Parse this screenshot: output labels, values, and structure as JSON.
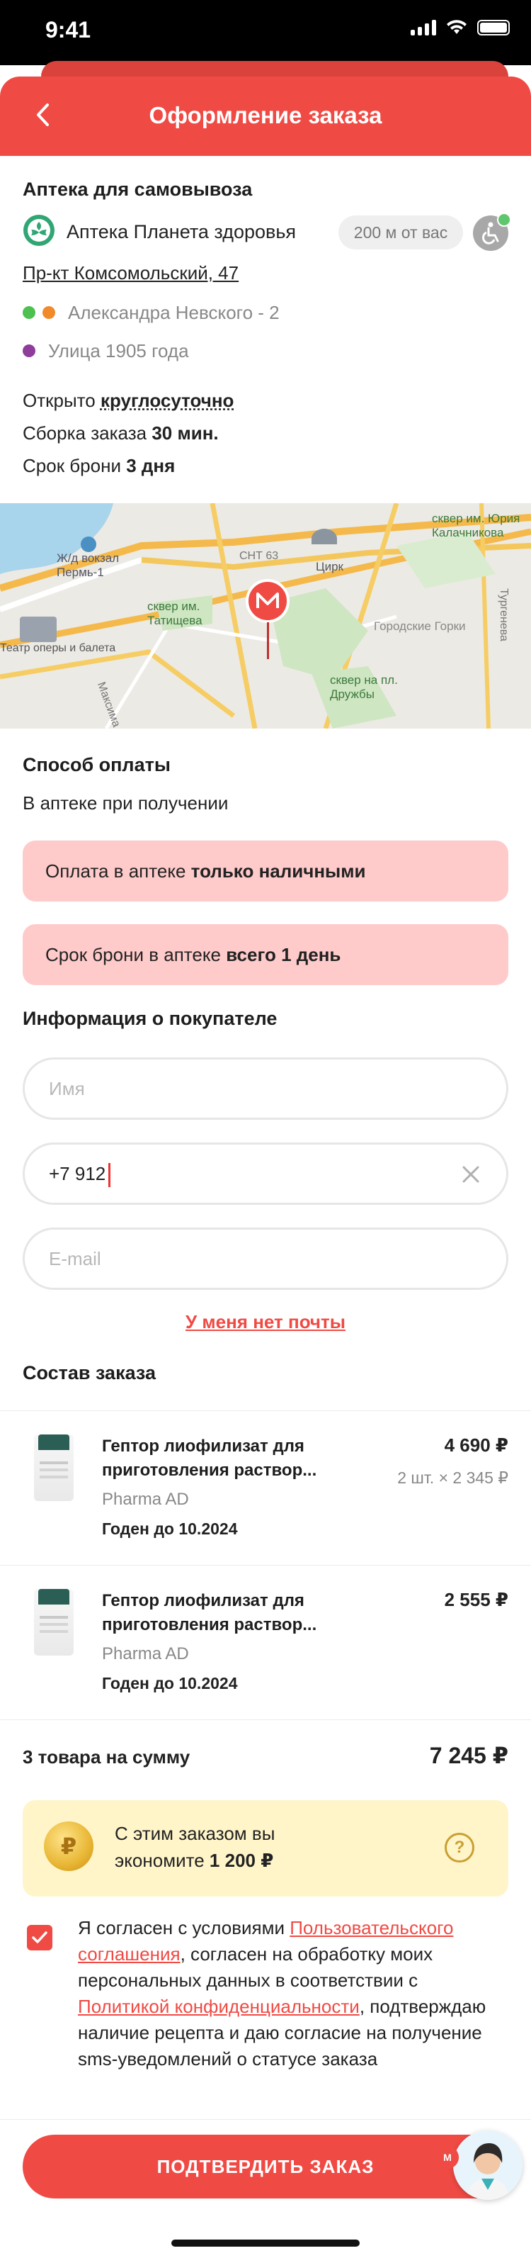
{
  "status_bar": {
    "time": "9:41"
  },
  "header": {
    "title": "Оформление заказа"
  },
  "pickup": {
    "section_title": "Аптека для самовывоза",
    "pharmacy_name": "Аптека Планета здоровья",
    "distance": "200 м от вас",
    "address": "Пр-кт Комсомольский, 47",
    "metro": [
      {
        "name": "Александра Невского - 2",
        "colors": [
          "#4cc14f",
          "#f08a2a"
        ]
      },
      {
        "name": "Улица 1905 года",
        "colors": [
          "#8e3d9b"
        ]
      }
    ],
    "open_prefix": "Открыто ",
    "open_value": "круглосуточно",
    "assembly_prefix": "Сборка заказа ",
    "assembly_value": "30 мин.",
    "reserve_prefix": "Срок брони ",
    "reserve_value": "3 дня"
  },
  "map": {
    "labels": [
      "Ж/д вокзал Пермь-1",
      "сквер им. Татищева",
      "СНТ 63",
      "Цирк",
      "сквер им. Юрия Калачникова",
      "Городские Горки",
      "сквер на пл. Дружбы",
      "Театр оперы и балета",
      "Максима Горького",
      "Тургенева"
    ]
  },
  "payment": {
    "section_title": "Способ оплаты",
    "method": "В аптеке при получении",
    "alert1_prefix": "Оплата в аптеке ",
    "alert1_bold": "только наличными",
    "alert2_prefix": "Срок брони в аптеке ",
    "alert2_bold": "всего 1 день"
  },
  "buyer": {
    "section_title": "Информация о покупателе",
    "name_placeholder": "Имя",
    "phone_value": "+7 912",
    "email_placeholder": "E-mail",
    "no_email_link": "У меня нет почты"
  },
  "order": {
    "section_title": "Состав заказа",
    "items": [
      {
        "name_line1": "Гептор лиофилизат для",
        "name_line2": "приготовления раствор...",
        "maker": "Pharma AD",
        "expiry": "Годен до 10.2024",
        "price": "4 690 ₽",
        "qty": "2  шт. × 2 345 ₽"
      },
      {
        "name_line1": "Гептор лиофилизат для",
        "name_line2": "приготовления раствор...",
        "maker": "Pharma AD",
        "expiry": "Годен до 10.2024",
        "price": "2 555 ₽",
        "qty": ""
      }
    ],
    "total_label": "3 товара на сумму",
    "total_value": "7 245 ₽"
  },
  "savings": {
    "line1": "С этим заказом вы",
    "line2_prefix": "экономите ",
    "line2_bold": "1 200 ₽"
  },
  "consent": {
    "t1": "Я согласен с условиями ",
    "link1": "Пользовательского соглашения",
    "t2": ", согласен на обработку моих персональных данных в соответствии с ",
    "link2": "Политикой конфиденциальности",
    "t3": ", подтверждаю наличие рецепта и даю согласие на получение sms-уведомлений о статусе заказа"
  },
  "confirm_button": "ПОДТВЕРДИТЬ ЗАКАЗ",
  "colors": {
    "accent": "#f04a44",
    "alert_bg": "#ffcaca",
    "savings_bg": "#fff5c9"
  },
  "icons": [
    "back-arrow-icon",
    "pharmacy-logo-icon",
    "wheelchair-icon",
    "clear-icon",
    "ruble-coin-icon",
    "question-icon",
    "checkbox-checked-icon",
    "map-pin-icon"
  ]
}
